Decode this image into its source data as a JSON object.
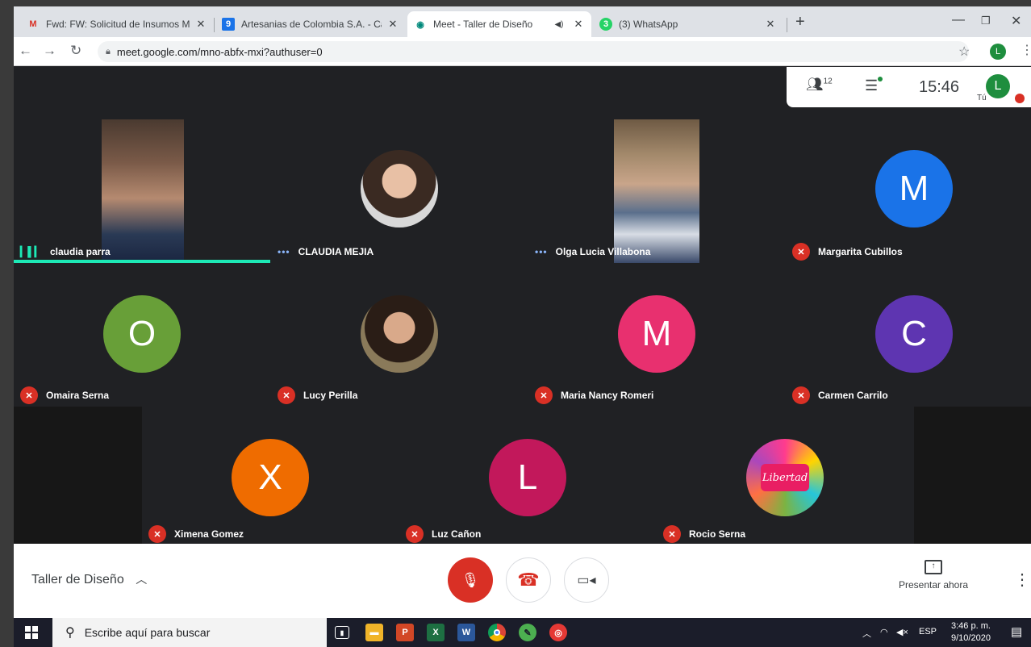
{
  "browser": {
    "tabs": [
      {
        "title": "Fwd: FW: Solicitud de Insumos M",
        "favicon": "gmail-icon",
        "fav_text": "M",
        "fav_color": "#d93025"
      },
      {
        "title": "Artesanias de Colombia S.A. - Ca",
        "favicon": "calendar-icon",
        "fav_text": "9",
        "fav_color": "#1a73e8"
      },
      {
        "title": "Meet - Taller de Diseño",
        "favicon": "meet-icon",
        "fav_text": "◉",
        "fav_color": "#00897b"
      },
      {
        "title": "(3) WhatsApp",
        "favicon": "whatsapp-icon",
        "fav_text": "3",
        "fav_color": "#25d366"
      }
    ],
    "url": "meet.google.com/mno-abfx-mxi?authuser=0",
    "profile_initial": "L"
  },
  "meet": {
    "participant_count": "12",
    "time": "15:46",
    "self_label": "Tú",
    "self_initial": "L",
    "meeting_name": "Taller de Diseño",
    "present_label": "Presentar ahora",
    "participants": [
      {
        "name": "claudia parra",
        "status": "speaking"
      },
      {
        "name": "CLAUDIA MEJIA",
        "status": "dots"
      },
      {
        "name": "Olga Lucia Villabona",
        "status": "dots"
      },
      {
        "name": "Margarita Cubillos",
        "status": "muted",
        "initial": "M",
        "color": "#1a73e8"
      },
      {
        "name": "Omaira Serna",
        "status": "muted",
        "initial": "O",
        "color": "#689f38"
      },
      {
        "name": "Lucy Perilla",
        "status": "muted"
      },
      {
        "name": "Maria Nancy Romeri",
        "status": "muted",
        "initial": "M",
        "color": "#e8306f"
      },
      {
        "name": "Carmen Carrilo",
        "status": "muted",
        "initial": "C",
        "color": "#5e35b1"
      },
      {
        "name": "Ximena Gomez",
        "status": "muted",
        "initial": "X",
        "color": "#ef6c00"
      },
      {
        "name": "Luz Cañon",
        "status": "muted",
        "initial": "L",
        "color": "#c2185b"
      },
      {
        "name": "Rocio Serna",
        "status": "muted",
        "logo_text": "Libertad"
      }
    ]
  },
  "taskbar": {
    "search_placeholder": "Escribe aquí para buscar",
    "lang": "ESP",
    "clock_time": "3:46 p. m.",
    "clock_date": "9/10/2020"
  }
}
